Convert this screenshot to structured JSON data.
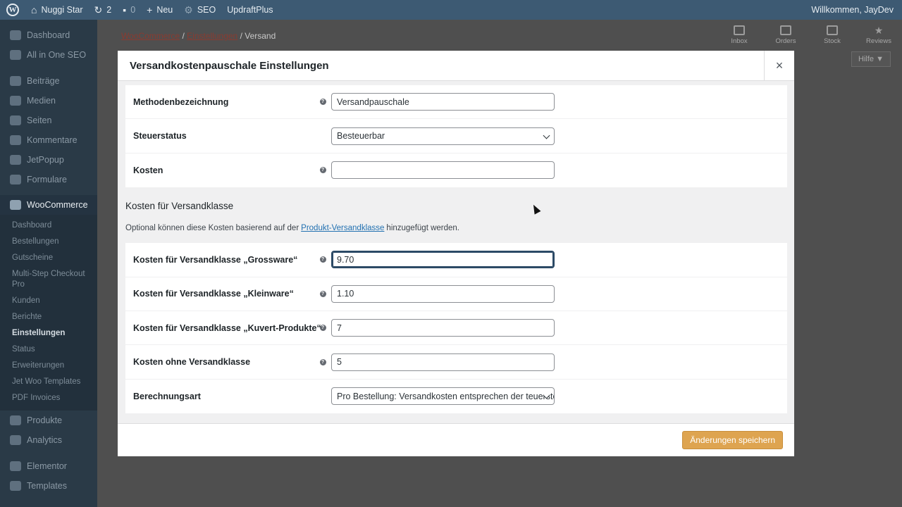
{
  "adminbar": {
    "site": "Nuggi Star",
    "updates_count": "2",
    "comments_count": "0",
    "new_label": "Neu",
    "seo_label": "SEO",
    "updraft_label": "UpdraftPlus",
    "welcome": "Willkommen, JayDev"
  },
  "sidebar": {
    "items_top": [
      {
        "label": "Dashboard",
        "icon": "dashboard-icon"
      },
      {
        "label": "All in One SEO",
        "icon": "seo-icon"
      },
      {
        "label": "Beiträge",
        "icon": "pin-icon"
      },
      {
        "label": "Medien",
        "icon": "media-icon"
      },
      {
        "label": "Seiten",
        "icon": "pages-icon"
      },
      {
        "label": "Kommentare",
        "icon": "comment-icon"
      },
      {
        "label": "JetPopup",
        "icon": "popup-icon"
      },
      {
        "label": "Formulare",
        "icon": "mail-icon"
      }
    ],
    "active": {
      "label": "WooCommerce",
      "icon": "woo-icon"
    },
    "submenu": [
      "Dashboard",
      "Bestellungen",
      "Gutscheine",
      "Multi-Step Checkout Pro",
      "Kunden",
      "Berichte",
      "Einstellungen",
      "Status",
      "Erweiterungen",
      "Jet Woo Templates",
      "PDF Invoices"
    ],
    "items_bottom": [
      {
        "label": "Produkte",
        "icon": "products-icon"
      },
      {
        "label": "Analytics",
        "icon": "analytics-icon"
      },
      {
        "label": "Elementor",
        "icon": "elementor-icon"
      },
      {
        "label": "Templates",
        "icon": "templates-icon"
      }
    ]
  },
  "breadcrumb": {
    "woocommerce": "WooCommerce",
    "settings": "Einstellungen",
    "current": "Versand"
  },
  "top_actions": [
    "Inbox",
    "Orders",
    "Stock",
    "Reviews"
  ],
  "help_label": "Hilfe ▼",
  "modal": {
    "title": "Versandkostenpauschale Einstellungen",
    "close": "×",
    "fields_top": [
      {
        "label": "Methodenbezeichnung",
        "value": "Versandpauschale",
        "type": "text",
        "help": true
      },
      {
        "label": "Steuerstatus",
        "value": "Besteuerbar",
        "type": "select",
        "help": false
      },
      {
        "label": "Kosten",
        "value": "",
        "type": "text",
        "help": true
      }
    ],
    "section_title": "Kosten für Versandklasse",
    "section_desc_before": "Optional können diese Kosten basierend auf der",
    "section_desc_link": "Produkt-Versandklasse",
    "section_desc_after": "hinzugefügt werden.",
    "fields_class": [
      {
        "label": "Kosten für Versandklasse „Grossware“",
        "value": "9.70",
        "type": "text",
        "help": true
      },
      {
        "label": "Kosten für Versandklasse „Kleinware“",
        "value": "1.10",
        "type": "text",
        "help": true
      },
      {
        "label": "Kosten für Versandklasse „Kuvert-Produkte“",
        "value": "7",
        "type": "text",
        "help": true
      },
      {
        "label": "Kosten ohne Versandklasse",
        "value": "5",
        "type": "text",
        "help": true
      },
      {
        "label": "Berechnungsart",
        "value": "Pro Bestellung: Versandkosten entsprechen der teuersten",
        "type": "select",
        "help": false
      }
    ],
    "save_label": "Änderungen speichern"
  }
}
